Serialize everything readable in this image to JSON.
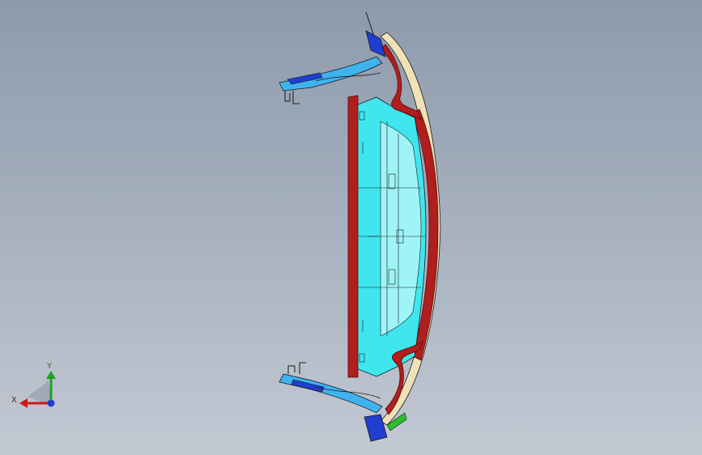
{
  "viewport": {
    "background_top": "#8e9aab",
    "background_bottom": "#c3c9d3"
  },
  "triad": {
    "x_label": "X",
    "y_label": "Y",
    "x_color": "#d01818",
    "y_color": "#1fa21f",
    "z_color": "#1f3fd0"
  },
  "model": {
    "colors": {
      "panel": "#3fe6ee",
      "panel_light": "#9ff4f7",
      "trim": "#b01e1e",
      "trim_dark": "#7a1010",
      "beige": "#efe2b8",
      "bracket": "#1f3fd0",
      "line": "#1a1a1a"
    }
  }
}
